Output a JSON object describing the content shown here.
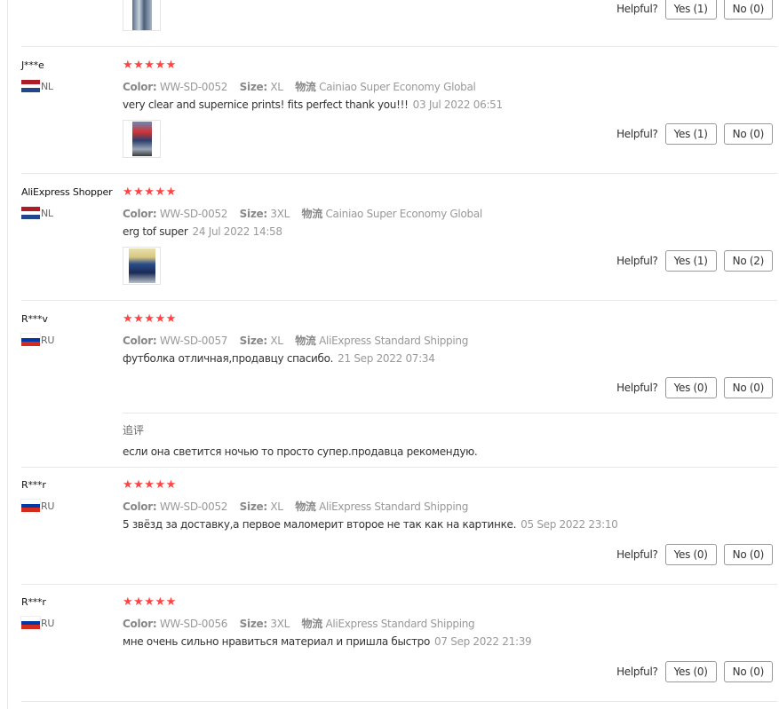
{
  "labels": {
    "color": "Color:",
    "size": "Size:",
    "shipping": "物流",
    "helpful": "Helpful?"
  },
  "colors": {
    "star": "#ff4747",
    "flag_nl": [
      "#ae1c28",
      "#ffffff",
      "#21468b"
    ],
    "flag_ru": [
      "#ffffff",
      "#0039a6",
      "#d52b1e"
    ]
  },
  "reviews": [
    {
      "has_user": false,
      "thumb": {
        "icon": "review-photo-jeans"
      },
      "helpful": {
        "yes": "Yes (1)",
        "no": "No (0)"
      }
    },
    {
      "user": "J***e",
      "country": "NL",
      "stars": "★★★★★",
      "color": "WW-SD-0052",
      "size": "XL",
      "shipping": "Cainiao Super Economy Global",
      "text": "very clear and supernice prints! fits perfect thank you!!!",
      "date": "03 Jul 2022 06:51",
      "thumb": {
        "icon": "review-photo-shirt"
      },
      "helpful": {
        "yes": "Yes (1)",
        "no": "No (0)"
      }
    },
    {
      "user": "AliExpress Shopper",
      "country": "NL",
      "stars": "★★★★★",
      "color": "WW-SD-0052",
      "size": "3XL",
      "shipping": "Cainiao Super Economy Global",
      "text": "erg tof super",
      "date": "24 Jul 2022 14:58",
      "thumb": {
        "icon": "review-photo-person"
      },
      "helpful": {
        "yes": "Yes (1)",
        "no": "No (2)"
      }
    },
    {
      "user": "R***v",
      "country": "RU",
      "stars": "★★★★★",
      "color": "WW-SD-0057",
      "size": "XL",
      "shipping": "AliExpress Standard Shipping",
      "text": "футболка отличная,продавцу спасибо.",
      "date": "21 Sep 2022 07:34",
      "helpful": {
        "yes": "Yes (0)",
        "no": "No (0)"
      },
      "additional": {
        "label": "追评",
        "text": "если она светится ночью то просто супер.продавца рекомендую."
      }
    },
    {
      "user": "R***r",
      "country": "RU",
      "stars": "★★★★★",
      "color": "WW-SD-0052",
      "size": "XL",
      "shipping": "AliExpress Standard Shipping",
      "text": "5 звёзд за доставку,а первое маломерит второе не так как на картинке.",
      "date": "05 Sep 2022 23:10",
      "helpful": {
        "yes": "Yes (0)",
        "no": "No (0)"
      }
    },
    {
      "user": "R***r",
      "country": "RU",
      "stars": "★★★★★",
      "color": "WW-SD-0056",
      "size": "3XL",
      "shipping": "AliExpress Standard Shipping",
      "text": "мне очень сильно нравиться материал и пришла быстро",
      "date": "07 Sep 2022 21:39",
      "helpful": {
        "yes": "Yes (0)",
        "no": "No (0)"
      }
    }
  ]
}
